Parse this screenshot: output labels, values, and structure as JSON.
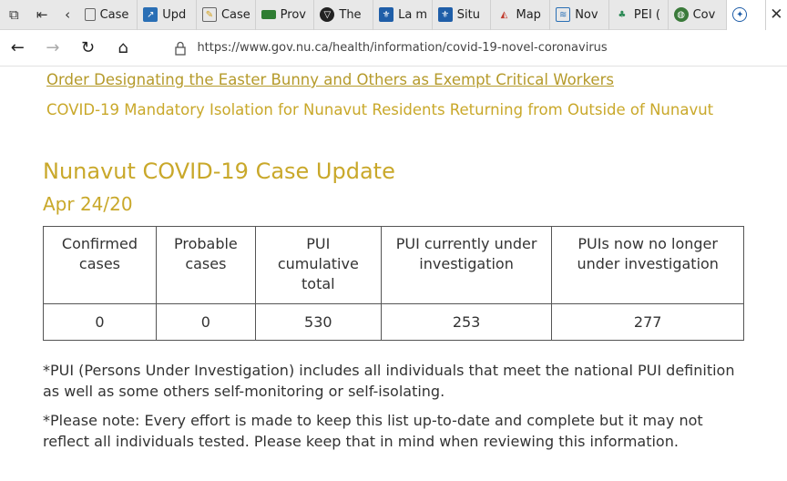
{
  "browser": {
    "tabs": [
      {
        "label": "Case",
        "icon": "doc-icon",
        "color": "#ffffff"
      },
      {
        "label": "Upd",
        "icon": "chart-icon",
        "color": "#2a6fb5"
      },
      {
        "label": "Case",
        "icon": "doc-icon",
        "color": "#d4a017"
      },
      {
        "label": "Prov",
        "icon": "flag-icon",
        "color": "#2e7d32"
      },
      {
        "label": "The",
        "icon": "shield-icon",
        "color": "#222222"
      },
      {
        "label": "La m",
        "icon": "fleur-icon",
        "color": "#1f5ea8"
      },
      {
        "label": "Situ",
        "icon": "fleur-icon",
        "color": "#1f5ea8"
      },
      {
        "label": "Map",
        "icon": "map-icon",
        "color": "#c0392b"
      },
      {
        "label": "Nov",
        "icon": "flag-icon",
        "color": "#2a6fb5"
      },
      {
        "label": "PEI (",
        "icon": "tree-icon",
        "color": "#2e8b57"
      },
      {
        "label": "Cov",
        "icon": "globe-icon",
        "color": "#3a7a3a"
      },
      {
        "label": "",
        "icon": "nunavut-icon",
        "color": "#1f5ea8"
      }
    ],
    "url": "https://www.gov.nu.ca/health/information/covid-19-novel-coronavirus"
  },
  "page": {
    "link1": "Order Designating the Easter Bunny and Others as Exempt Critical Workers",
    "link2": "COVID-19 Mandatory Isolation for Nunavut Residents Returning from Outside of Nunavut",
    "title": "Nunavut COVID-19 Case Update",
    "date": "Apr 24/20",
    "table": {
      "headers": [
        "Confirmed cases",
        "Probable cases",
        "PUI cumulative total",
        "PUI currently under investigation",
        "PUIs now no longer under investigation"
      ],
      "row": [
        "0",
        "0",
        "530",
        "253",
        "277"
      ]
    },
    "note1": "*PUI (Persons Under Investigation) includes all individuals that meet the national PUI definition as well as some others self-monitoring or self-isolating.",
    "note2": "*Please note: Every effort is made to keep this list up-to-date and complete but it may not reflect all individuals tested. Please keep that in mind when reviewing this information."
  }
}
